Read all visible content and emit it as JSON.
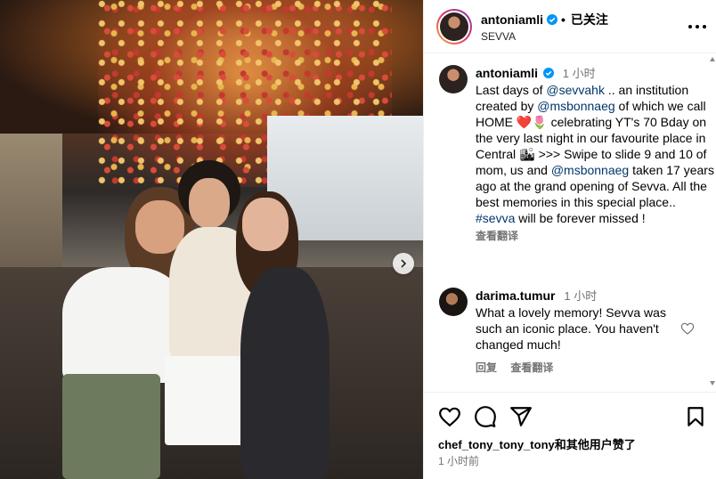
{
  "header": {
    "username": "antoniamli",
    "follow_state": "已关注",
    "location": "SEVVA",
    "dot": "•"
  },
  "caption": {
    "username": "antoniamli",
    "time": "1 小时",
    "t1": "Last days of ",
    "link1": "@sevvahk",
    "t2": " .. an institution created by ",
    "link2": "@msbonnaeg",
    "t3": " of which we call HOME ❤️🌷 celebrating YT's 70 Bday on the very last night in our favourite place in Central 🏙 >>> Swipe to slide 9 and 10 of mom, us and ",
    "link3": "@msbonnaeg",
    "t4": " taken 17 years ago at the grand opening of Sevva. All the best memories in this special place.. ",
    "link4": "#sevva",
    "t5": " will be forever missed !",
    "translate": "查看翻译"
  },
  "comment": {
    "username": "darima.tumur",
    "time": "1 小时",
    "text": "What a lovely memory! Sevva was such an iconic place. You haven't changed much!",
    "reply": "回复",
    "translate": "查看翻译"
  },
  "footer": {
    "likes": "chef_tony_tony_tony和其他用户赞了",
    "time": "1 小时前"
  },
  "icons": {
    "verified": "verified-badge-icon",
    "more": "more-options-icon",
    "like": "heart-icon",
    "comment": "comment-icon",
    "share": "share-icon",
    "save": "bookmark-icon",
    "next": "chevron-right-icon"
  },
  "colors": {
    "link": "#00376b",
    "verified": "#0095f6",
    "muted": "#737373"
  }
}
